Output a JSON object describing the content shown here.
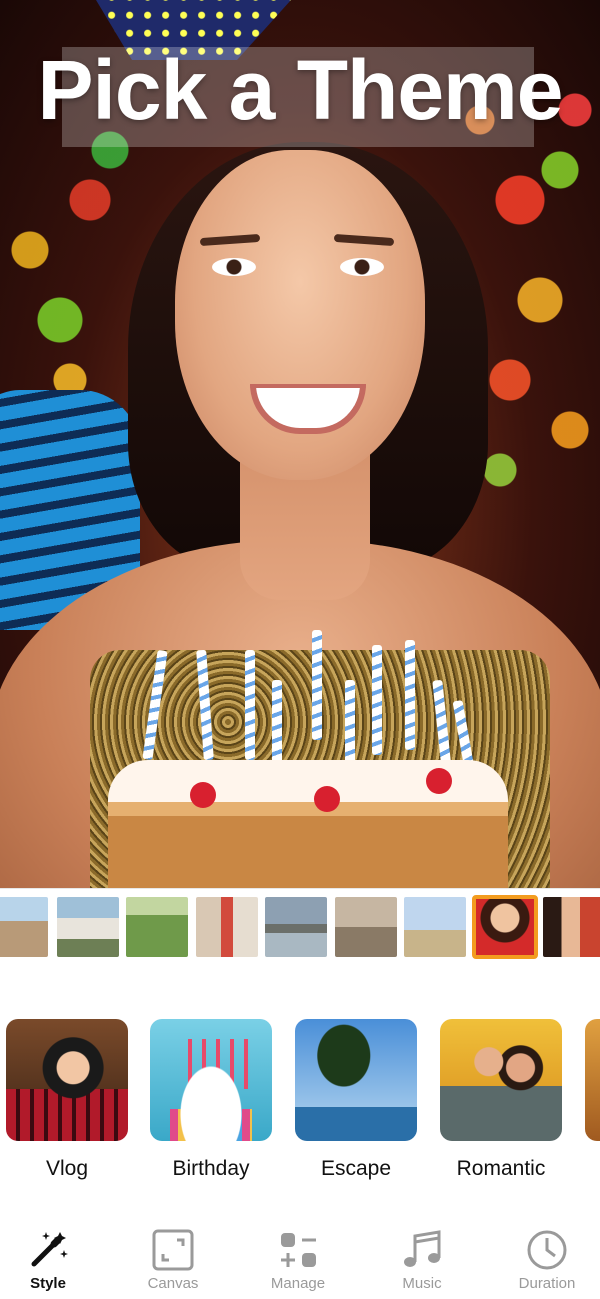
{
  "preview": {
    "title": "Pick a Theme"
  },
  "filmstrip": {
    "thumbnail_count": 10,
    "selected_index": 8
  },
  "themes": [
    {
      "label": "Vlog"
    },
    {
      "label": "Birthday"
    },
    {
      "label": "Escape"
    },
    {
      "label": "Romantic"
    }
  ],
  "tabs": [
    {
      "label": "Style",
      "icon": "magic-wand-icon",
      "active": true
    },
    {
      "label": "Canvas",
      "icon": "canvas-resize-icon",
      "active": false
    },
    {
      "label": "Manage",
      "icon": "manage-icon",
      "active": false
    },
    {
      "label": "Music",
      "icon": "music-note-icon",
      "active": false
    },
    {
      "label": "Duration",
      "icon": "clock-icon",
      "active": false
    }
  ],
  "colors": {
    "selection": "#f39c1f",
    "active_tab": "#111111",
    "inactive_tab": "#9a9a9a"
  }
}
